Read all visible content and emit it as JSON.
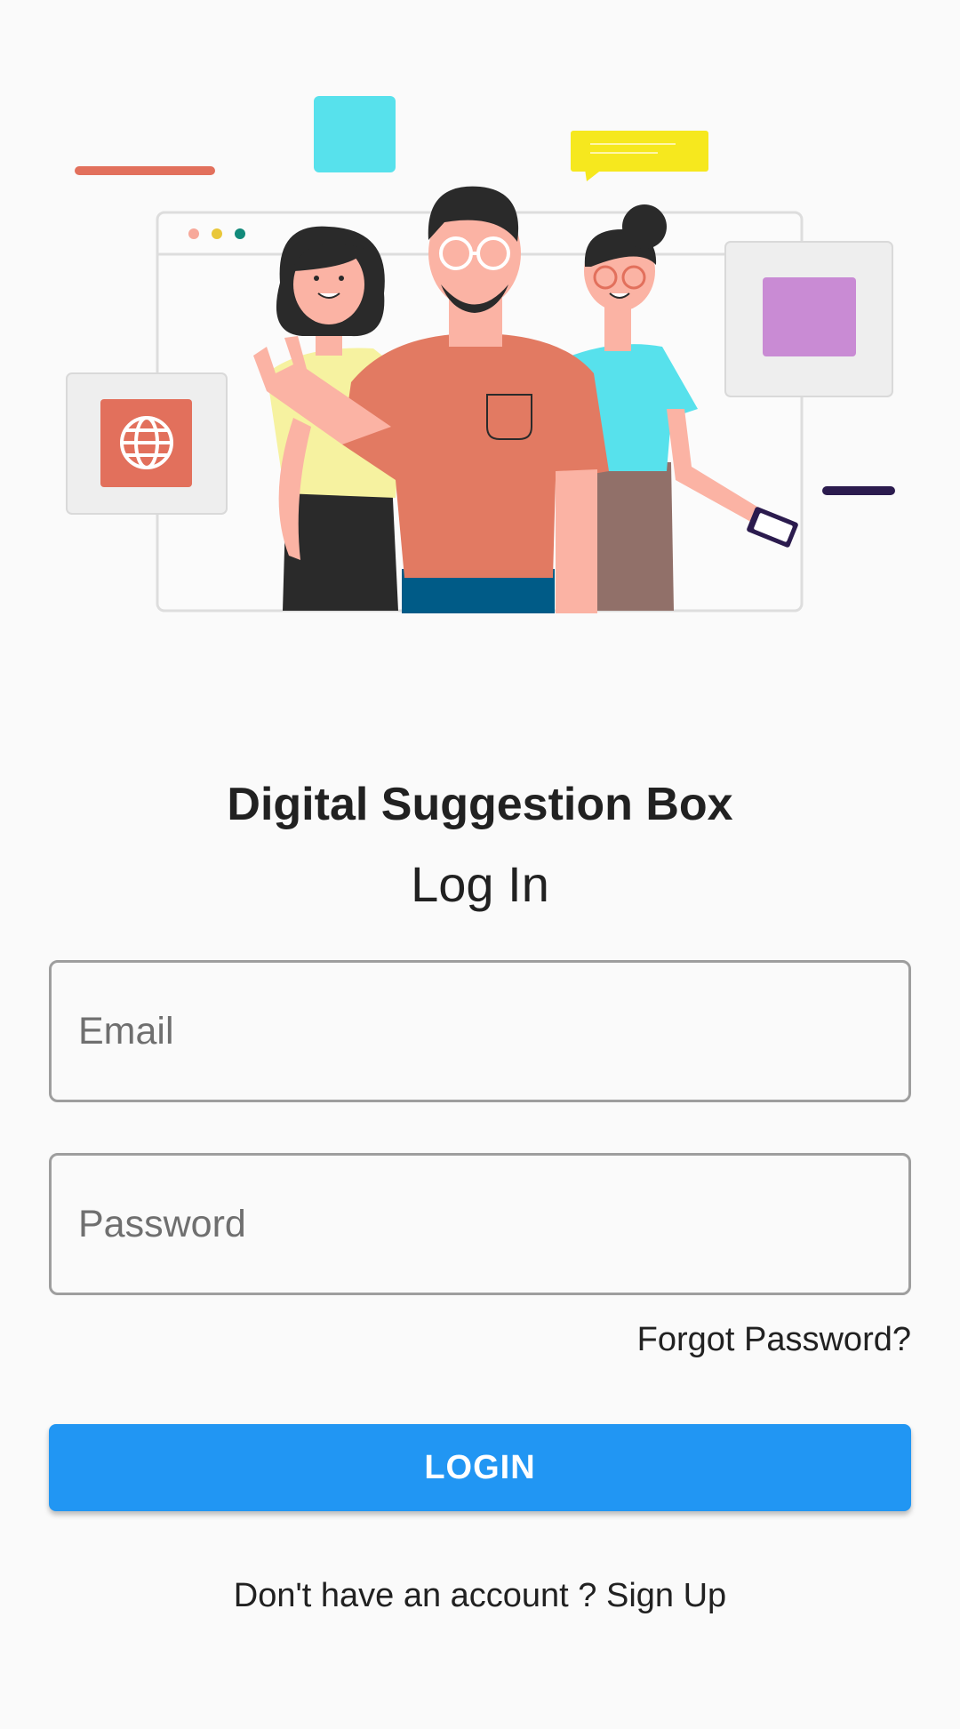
{
  "app": {
    "title": "Digital Suggestion Box",
    "screen_title": "Log In"
  },
  "form": {
    "email_placeholder": "Email",
    "email_value": "",
    "password_placeholder": "Password",
    "password_value": "",
    "forgot_password_label": "Forgot Password?",
    "login_label": "LOGIN"
  },
  "footer": {
    "prompt": "Don't have an account ? ",
    "signup_label": "Sign Up"
  },
  "illustration": {
    "icon": "globe-icon"
  },
  "colors": {
    "background": "#fafafa",
    "primary": "#2196f3",
    "text": "#212121",
    "border": "#9e9e9e"
  }
}
